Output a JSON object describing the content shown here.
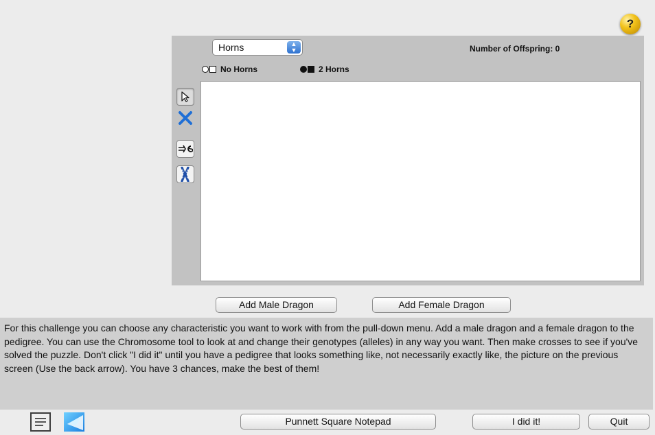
{
  "help": {
    "label": "?"
  },
  "trait_select": {
    "value": "Horns",
    "arrow_up": "▲",
    "arrow_down": "▼"
  },
  "offspring": {
    "label": "Number of Offspring: 0"
  },
  "legend": [
    {
      "label": "No Horns"
    },
    {
      "label": "2 Horns"
    }
  ],
  "tools": [
    {
      "name": "pointer"
    },
    {
      "name": "delete"
    },
    {
      "name": "cross"
    },
    {
      "name": "chromosome"
    }
  ],
  "buttons": {
    "add_male": "Add Male Dragon",
    "add_female": "Add Female Dragon",
    "punnett": "Punnett Square Notepad",
    "did_it": "I did it!",
    "quit": "Quit"
  },
  "instructions": "For this challenge you can choose any characteristic you want to work with from the pull-down menu. Add a male dragon and a female dragon to the pedigree. You can use the Chromosome tool to look at and change their genotypes (alleles) in any way you want. Then make crosses to see if you've solved the puzzle.  Don't click \"I did it\" until you have a pedigree that looks something like, not necessarily exactly like, the picture on the previous screen (Use the back arrow).  You have 3 chances,  make the best of them!",
  "colors": {
    "panel": "#c2c2c2",
    "instructions_bg": "#cfcfcf",
    "accent_blue": "#1f6fd6"
  }
}
